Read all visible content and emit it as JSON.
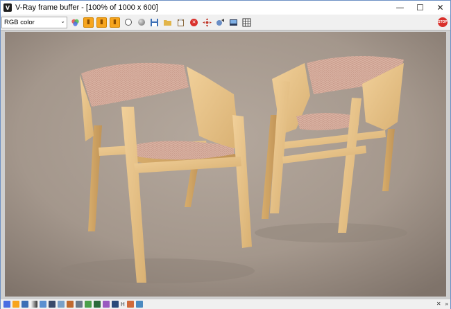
{
  "window": {
    "title": "V-Ray frame buffer - [100% of 1000 x 600]",
    "icon_label": "V"
  },
  "titlebar_buttons": {
    "minimize": "—",
    "maximize": "☐",
    "close": "✕"
  },
  "toolbar": {
    "channel_select_value": "RGB color",
    "stop_label": "STOP",
    "icons": [
      "channel-select-icon",
      "color-channels-icon",
      "red-channel-icon",
      "green-channel-icon",
      "blue-channel-icon",
      "white-dot-icon",
      "grey-dot-icon",
      "save-icon",
      "load-icon",
      "clipboard-icon",
      "clear-icon",
      "track-mouse-icon",
      "region-render-icon",
      "display-icon",
      "grid-icon"
    ]
  },
  "statusbar": {
    "letter_h": "H",
    "right_x": "✕",
    "right_chev": "»"
  },
  "colors": {
    "toolbar_orange": "#f7a51e",
    "stop_red": "#d9302b",
    "background_render": "#a99d92",
    "wood": "#e8c48c",
    "fabric": "#d8b0a2"
  }
}
